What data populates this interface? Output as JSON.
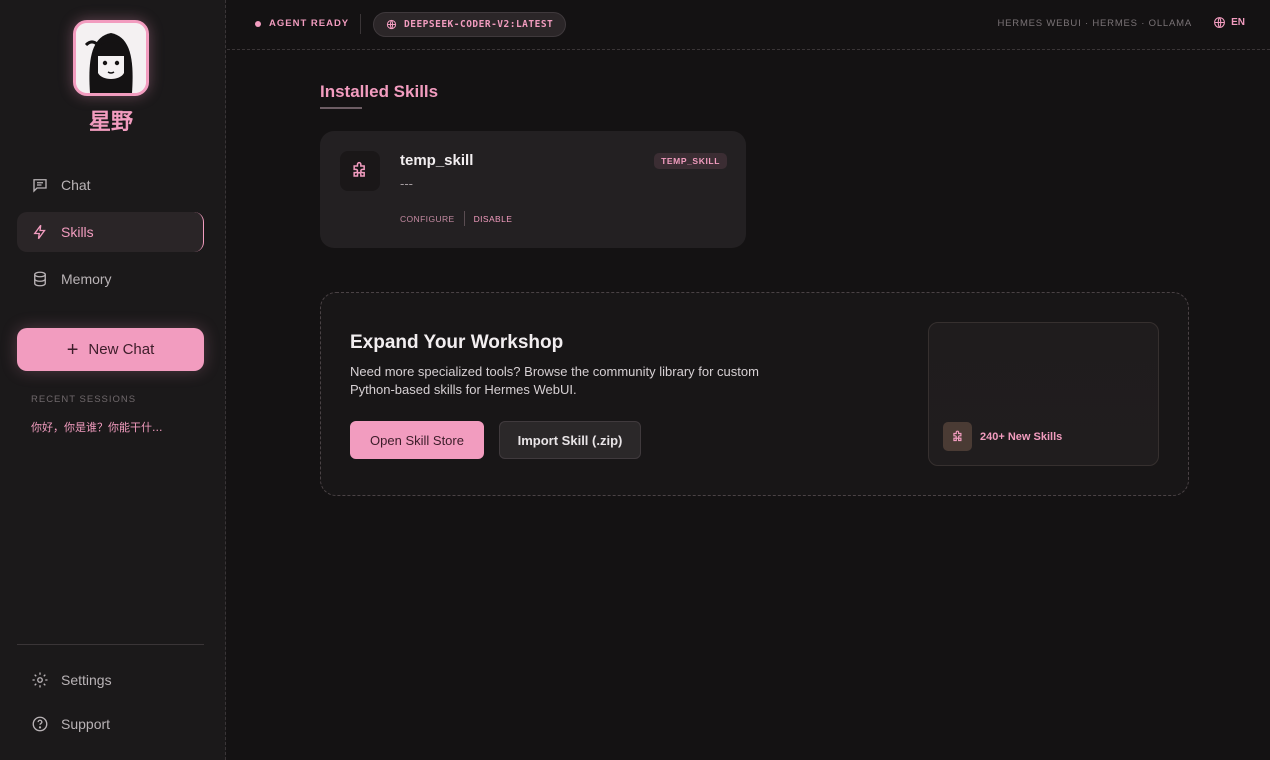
{
  "brand": {
    "name": "星野"
  },
  "nav": {
    "chat": "Chat",
    "skills": "Skills",
    "memory": "Memory"
  },
  "new_chat": {
    "label": "New Chat"
  },
  "recent": {
    "title": "RECENT SESSIONS",
    "items": [
      "你好，你是谁？你能干什..."
    ]
  },
  "footer_nav": {
    "settings": "Settings",
    "support": "Support"
  },
  "topbar": {
    "status": "AGENT READY",
    "model": "DEEPSEEK-CODER-V2:LATEST",
    "breadcrumb": "HERMES WEBUI · HERMES · OLLAMA",
    "language": "EN"
  },
  "installed": {
    "title": "Installed Skills",
    "skills": [
      {
        "name": "temp_skill",
        "description": "---",
        "tag": "TEMP_SKILL",
        "configure": "CONFIGURE",
        "disable": "DISABLE",
        "icon": "puzzle-icon"
      }
    ]
  },
  "workshop": {
    "title": "Expand Your Workshop",
    "description": "Need more specialized tools? Browse the community library for custom Python-based skills for Hermes WebUI.",
    "store_button": "Open Skill Store",
    "import_button": "Import Skill (.zip)",
    "badge": "240+ New Skills"
  },
  "colors": {
    "accent": "#f29cbf",
    "background": "#141213",
    "sidebar": "#1b191a"
  }
}
